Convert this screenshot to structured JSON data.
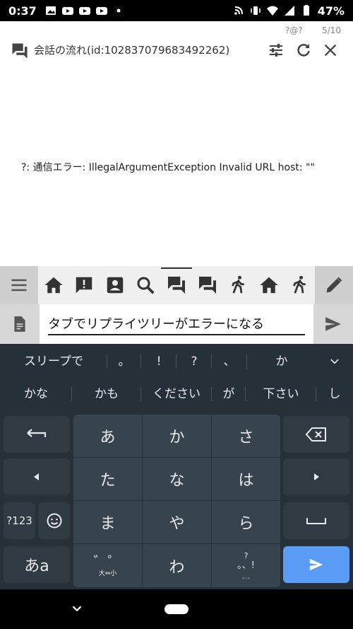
{
  "statusbar": {
    "time": "0:37",
    "battery": "47%"
  },
  "appbar": {
    "counter_left": "?@?",
    "counter_right": "5/10",
    "title": "会話の流れ(id:102837079683492262)"
  },
  "content": {
    "error_text": "?: 通信エラー: IllegalArgumentException Invalid URL host: \"\""
  },
  "compose": {
    "value": "タブでリプライツリーがエラーになる"
  },
  "keyboard": {
    "candidates_row1": [
      "スリープで",
      "。",
      "!",
      "?",
      "、",
      "か"
    ],
    "candidates_row2": [
      "かな",
      "かも",
      "ください",
      "が",
      "下さい",
      "し"
    ],
    "keys": {
      "a": "あ",
      "ka": "か",
      "sa": "さ",
      "ta": "た",
      "na": "な",
      "ha": "は",
      "ma": "ま",
      "ya": "や",
      "ra": "ら",
      "dakuten": "゛゜",
      "dakuten_sub": "大⇔小",
      "wa": "わ",
      "punct_top": "?",
      "punct_mid": "。、!",
      "punct_bottom": "…",
      "mode_123": "?123",
      "kana_mode": "あa"
    }
  },
  "colors": {
    "keyboard_bg": "#263038",
    "key_bg": "#37434d",
    "enter_bg": "#5b9cf6",
    "toolbar_bg": "#e2e2e2"
  }
}
